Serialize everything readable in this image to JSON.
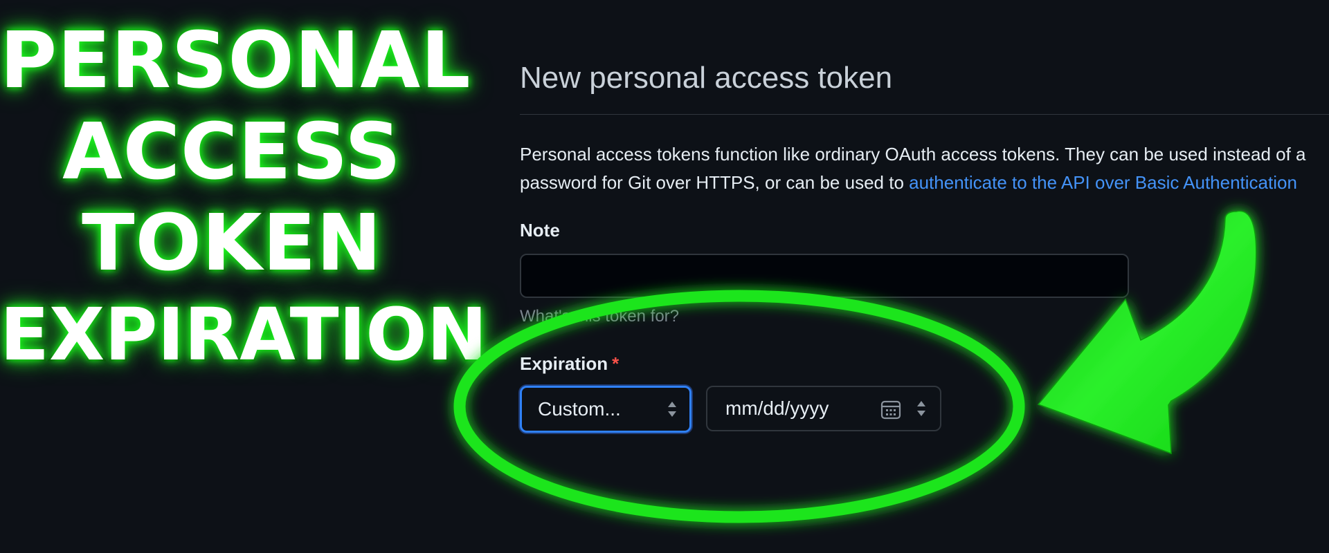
{
  "overlay": {
    "line1": "PERSONAL",
    "line2": "ACCESS",
    "line3": "TOKEN",
    "line4": "EXPIRATION"
  },
  "page": {
    "title": "New personal access token",
    "intro_text_1": "Personal access tokens function like ordinary OAuth access tokens. They can be used instead of a",
    "intro_text_2": "password for Git over HTTPS, or can be used to ",
    "intro_link": "authenticate to the API over Basic Authentication",
    "note_label": "Note",
    "note_value": "",
    "note_hint": "What's this token for?",
    "expiration_label": "Expiration",
    "required_marker": "*",
    "expiration_select_value": "Custom...",
    "date_placeholder": "mm/dd/yyyy"
  },
  "colors": {
    "background": "#0d1117",
    "link": "#4493f8",
    "focus_border": "#2f81f7",
    "required": "#f85149",
    "annotation_green": "#1ee51e"
  },
  "icons": {
    "calendar": "calendar-icon",
    "select_arrows": "up-down-arrows-icon",
    "annotation_arrow": "curved-arrow-icon"
  }
}
